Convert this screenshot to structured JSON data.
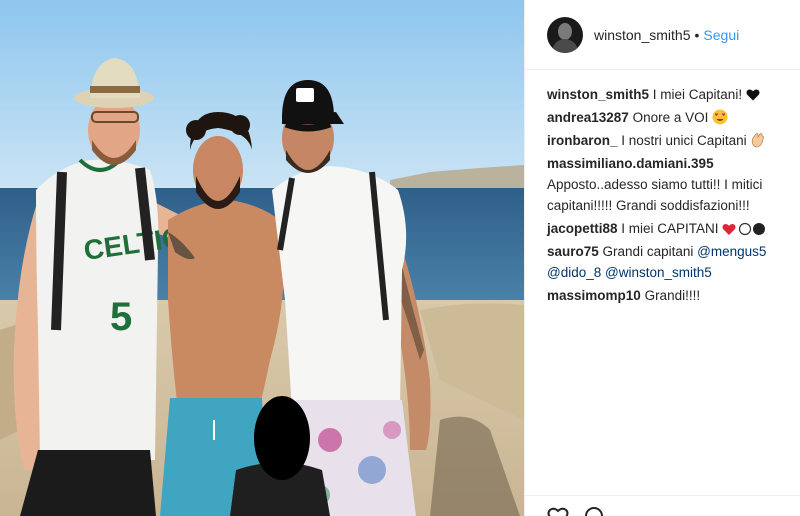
{
  "post": {
    "author": "winston_smith5",
    "follow_label": "Segui",
    "separator": "•"
  },
  "photo": {
    "jersey_text": "CELTICS",
    "jersey_number": "5"
  },
  "comments": [
    {
      "user": "winston_smith5",
      "text": "I miei Capitani!",
      "emoji": "heart-black-icon"
    },
    {
      "user": "andrea13287",
      "text": "Onore a VOI",
      "emoji": "heart-eyes-icon"
    },
    {
      "user": "ironbaron_",
      "text": "I nostri unici Capitani",
      "emoji": "clap-icon"
    },
    {
      "user": "massimiliano.damiani.395",
      "text": "Apposto..adesso siamo tutti!! I mitici capitani!!!!! Grandi soddisfazioni!!!"
    },
    {
      "user": "jacopetti88",
      "text": "I miei CAPITANI",
      "emoji": "heart-circles-icon"
    },
    {
      "user": "sauro75",
      "text": "Grandi capitani",
      "mentions": [
        "@mengus5",
        "@dido_8",
        "@winston_smith5"
      ]
    },
    {
      "user": "massimomp10",
      "text": "Grandi!!!!"
    }
  ],
  "colors": {
    "link_blue": "#3897f0",
    "mention_blue": "#003569",
    "text": "#262626",
    "border": "#efefef"
  }
}
